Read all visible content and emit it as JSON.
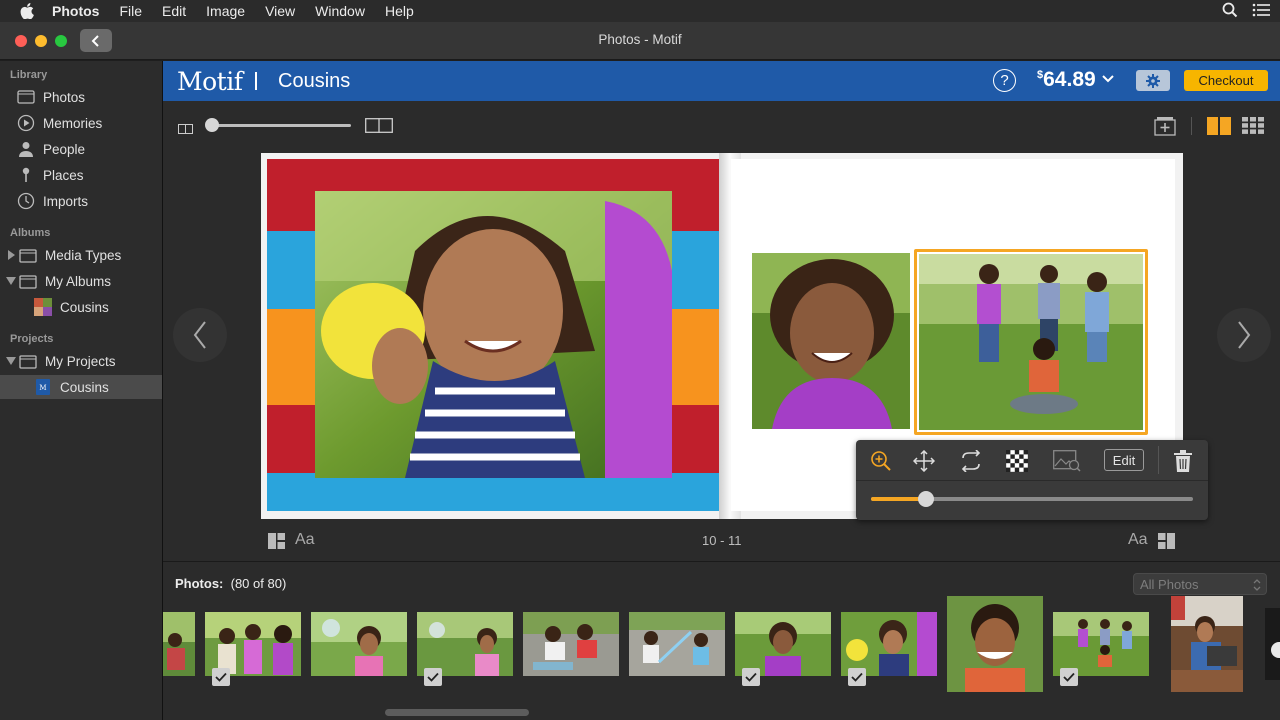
{
  "menubar": {
    "app_name": "Photos",
    "items": [
      "File",
      "Edit",
      "Image",
      "View",
      "Window",
      "Help"
    ]
  },
  "window": {
    "title": "Photos - Motif"
  },
  "sidebar": {
    "sections": {
      "library": "Library",
      "albums": "Albums",
      "projects": "Projects"
    },
    "library_items": [
      "Photos",
      "Memories",
      "People",
      "Places",
      "Imports"
    ],
    "album_items": [
      "Media Types",
      "My Albums",
      "Cousins"
    ],
    "project_items": [
      "My Projects",
      "Cousins"
    ]
  },
  "header": {
    "brand": "Motif",
    "project_name": "Cousins",
    "help_label": "?",
    "price_currency": "$",
    "price_value": "64.89",
    "checkout_label": "Checkout"
  },
  "popover": {
    "edit_label": "Edit",
    "zoom_level": 0.17
  },
  "book": {
    "page_numbers": "10 - 11",
    "text_style_left": "Aa",
    "text_style_right": "Aa"
  },
  "strip": {
    "label": "Photos:",
    "count": "(80 of 80)",
    "filter_value": "All Photos"
  },
  "colors": {
    "accent_blue": "#1f5aa8",
    "checkout_yellow": "#f7b500",
    "selection_orange": "#f5a623",
    "stripe_red": "#c01f2c",
    "stripe_blue": "#2aa4dc",
    "stripe_orange": "#f7931e"
  }
}
